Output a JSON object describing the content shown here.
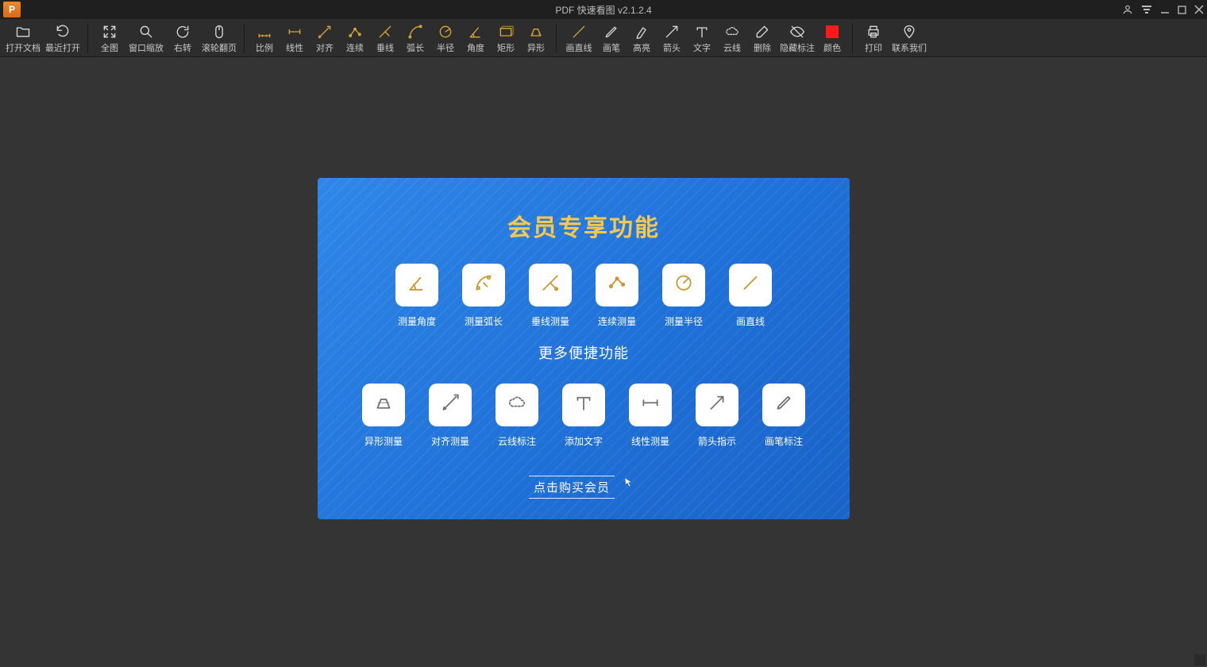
{
  "titlebar": {
    "logo_letter": "P",
    "title": "PDF 快速看图  v2.1.2.4"
  },
  "toolbar": {
    "groups": [
      {
        "items": [
          {
            "id": "open-file",
            "label": "打开文档",
            "icon": "folder"
          },
          {
            "id": "recent",
            "label": "最近打开",
            "icon": "history"
          }
        ]
      },
      {
        "items": [
          {
            "id": "full-view",
            "label": "全图",
            "icon": "expand"
          },
          {
            "id": "zoom-window",
            "label": "窗口缩放",
            "icon": "magnify"
          },
          {
            "id": "rotate-right",
            "label": "右转",
            "icon": "rotate"
          },
          {
            "id": "wheel-page",
            "label": "滚轮翻页",
            "icon": "mouse"
          }
        ]
      },
      {
        "items": [
          {
            "id": "scale",
            "label": "比例",
            "icon": "scale",
            "accent": true
          },
          {
            "id": "linear",
            "label": "线性",
            "icon": "linear",
            "accent": true
          },
          {
            "id": "align",
            "label": "对齐",
            "icon": "align",
            "accent": true
          },
          {
            "id": "continuous",
            "label": "连续",
            "icon": "cont",
            "accent": true
          },
          {
            "id": "perp",
            "label": "垂线",
            "icon": "perp",
            "accent": true
          },
          {
            "id": "arc",
            "label": "弧长",
            "icon": "arc",
            "accent": true
          },
          {
            "id": "radius",
            "label": "半径",
            "icon": "radius",
            "accent": true
          },
          {
            "id": "angle",
            "label": "角度",
            "icon": "angle",
            "accent": true
          },
          {
            "id": "rect",
            "label": "矩形",
            "icon": "rect",
            "accent": true
          },
          {
            "id": "irregular",
            "label": "异形",
            "icon": "irreg",
            "accent": true
          }
        ]
      },
      {
        "items": [
          {
            "id": "line",
            "label": "画直线",
            "icon": "line",
            "accent": true
          },
          {
            "id": "pencil",
            "label": "画笔",
            "icon": "pencil"
          },
          {
            "id": "highlight",
            "label": "高亮",
            "icon": "hl"
          },
          {
            "id": "arrow",
            "label": "箭头",
            "icon": "arrow"
          },
          {
            "id": "text",
            "label": "文字",
            "icon": "text"
          },
          {
            "id": "cloud",
            "label": "云线",
            "icon": "cloud"
          },
          {
            "id": "delete",
            "label": "删除",
            "icon": "eraser"
          },
          {
            "id": "hide-annot",
            "label": "隐藏标注",
            "icon": "eye"
          },
          {
            "id": "color",
            "label": "颜色",
            "icon": "color"
          }
        ]
      },
      {
        "items": [
          {
            "id": "print",
            "label": "打印",
            "icon": "print"
          },
          {
            "id": "contact",
            "label": "联系我们",
            "icon": "contact"
          }
        ]
      }
    ]
  },
  "promo": {
    "title": "会员专享功能",
    "subtitle": "更多便捷功能",
    "buy_label": "点击购买会员",
    "row1": [
      {
        "label": "测量角度",
        "icon": "p-angle"
      },
      {
        "label": "测量弧长",
        "icon": "p-arc"
      },
      {
        "label": "垂线测量",
        "icon": "p-perp"
      },
      {
        "label": "连续测量",
        "icon": "p-cont"
      },
      {
        "label": "测量半径",
        "icon": "p-radius"
      },
      {
        "label": "画直线",
        "icon": "p-line"
      }
    ],
    "row2": [
      {
        "label": "异形测量",
        "icon": "p-irreg"
      },
      {
        "label": "对齐测量",
        "icon": "p-align"
      },
      {
        "label": "云线标注",
        "icon": "p-cloud"
      },
      {
        "label": "添加文字",
        "icon": "p-text"
      },
      {
        "label": "线性测量",
        "icon": "p-linear"
      },
      {
        "label": "箭头指示",
        "icon": "p-arrow"
      },
      {
        "label": "画笔标注",
        "icon": "p-pencil"
      }
    ]
  }
}
